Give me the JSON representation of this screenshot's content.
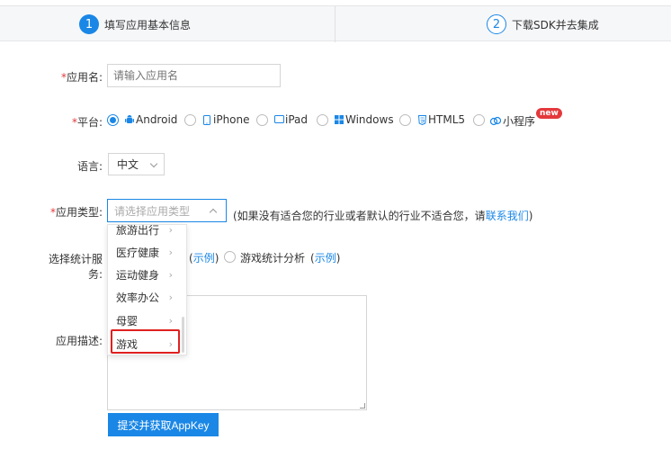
{
  "steps": [
    {
      "num": "1",
      "label": "填写应用基本信息"
    },
    {
      "num": "2",
      "label": "下载SDK并去集成"
    }
  ],
  "form": {
    "app_name": {
      "req": "*",
      "label": "应用名:",
      "placeholder": "请输入应用名"
    },
    "platform": {
      "req": "*",
      "label": "平台:",
      "options": [
        "Android",
        "iPhone",
        "iPad",
        "Windows",
        "HTML5",
        "小程序"
      ],
      "selected": "Android",
      "new_badge": "new"
    },
    "language": {
      "label": "语言:",
      "value": "中文"
    },
    "app_type": {
      "req": "*",
      "label": "应用类型:",
      "placeholder": "请选择应用类型",
      "hint_prefix": "(如果没有适合您的行业或者默认的行业不适合您，请",
      "hint_link": "联系我们",
      "hint_suffix": ")",
      "dropdown": [
        "旅游出行",
        "医疗健康",
        "运动健身",
        "效率办公",
        "母婴",
        "游戏"
      ],
      "highlighted": "游戏"
    },
    "stat_service": {
      "label": "选择统计服务:",
      "example1_open": "(",
      "example1": "示例",
      "example1_close": ")",
      "option2": "游戏统计分析",
      "example2_open": "(",
      "example2": "示例",
      "example2_close": ")"
    },
    "description": {
      "label": "应用描述:"
    },
    "submit_label": "提交并获取AppKey"
  },
  "colors": {
    "accent": "#1a87e6",
    "required": "#e4393c",
    "highlight": "#e02020"
  }
}
